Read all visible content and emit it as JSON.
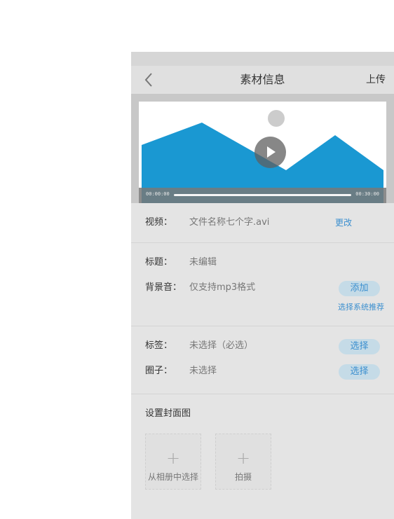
{
  "nav": {
    "title": "素材信息",
    "upload": "上传",
    "back_icon": "chevron-left-icon"
  },
  "player": {
    "time_start": "00:00:00",
    "time_end": "00:30:00",
    "colors": {
      "mountain": "#1a98d2",
      "sun": "#cccccc"
    }
  },
  "video_row": {
    "label": "视频：",
    "value": "文件名称七个字.avi",
    "action": "更改"
  },
  "info": {
    "title_label": "标题：",
    "title_value": "未编辑",
    "bgm_label": "背景音：",
    "bgm_value": "仅支持mp3格式",
    "bgm_action": "添加",
    "bgm_recommend": "选择系统推荐"
  },
  "tags": {
    "tag_label": "标签：",
    "tag_value": "未选择（必选）",
    "tag_action": "选择",
    "circle_label": "圈子：",
    "circle_value": "未选择",
    "circle_action": "选择"
  },
  "cover": {
    "title": "设置封面图",
    "options": [
      {
        "icon": "+",
        "label": "从相册中选择"
      },
      {
        "icon": "+",
        "label": "拍摄"
      }
    ]
  },
  "accent_color": "#3b8fcf"
}
